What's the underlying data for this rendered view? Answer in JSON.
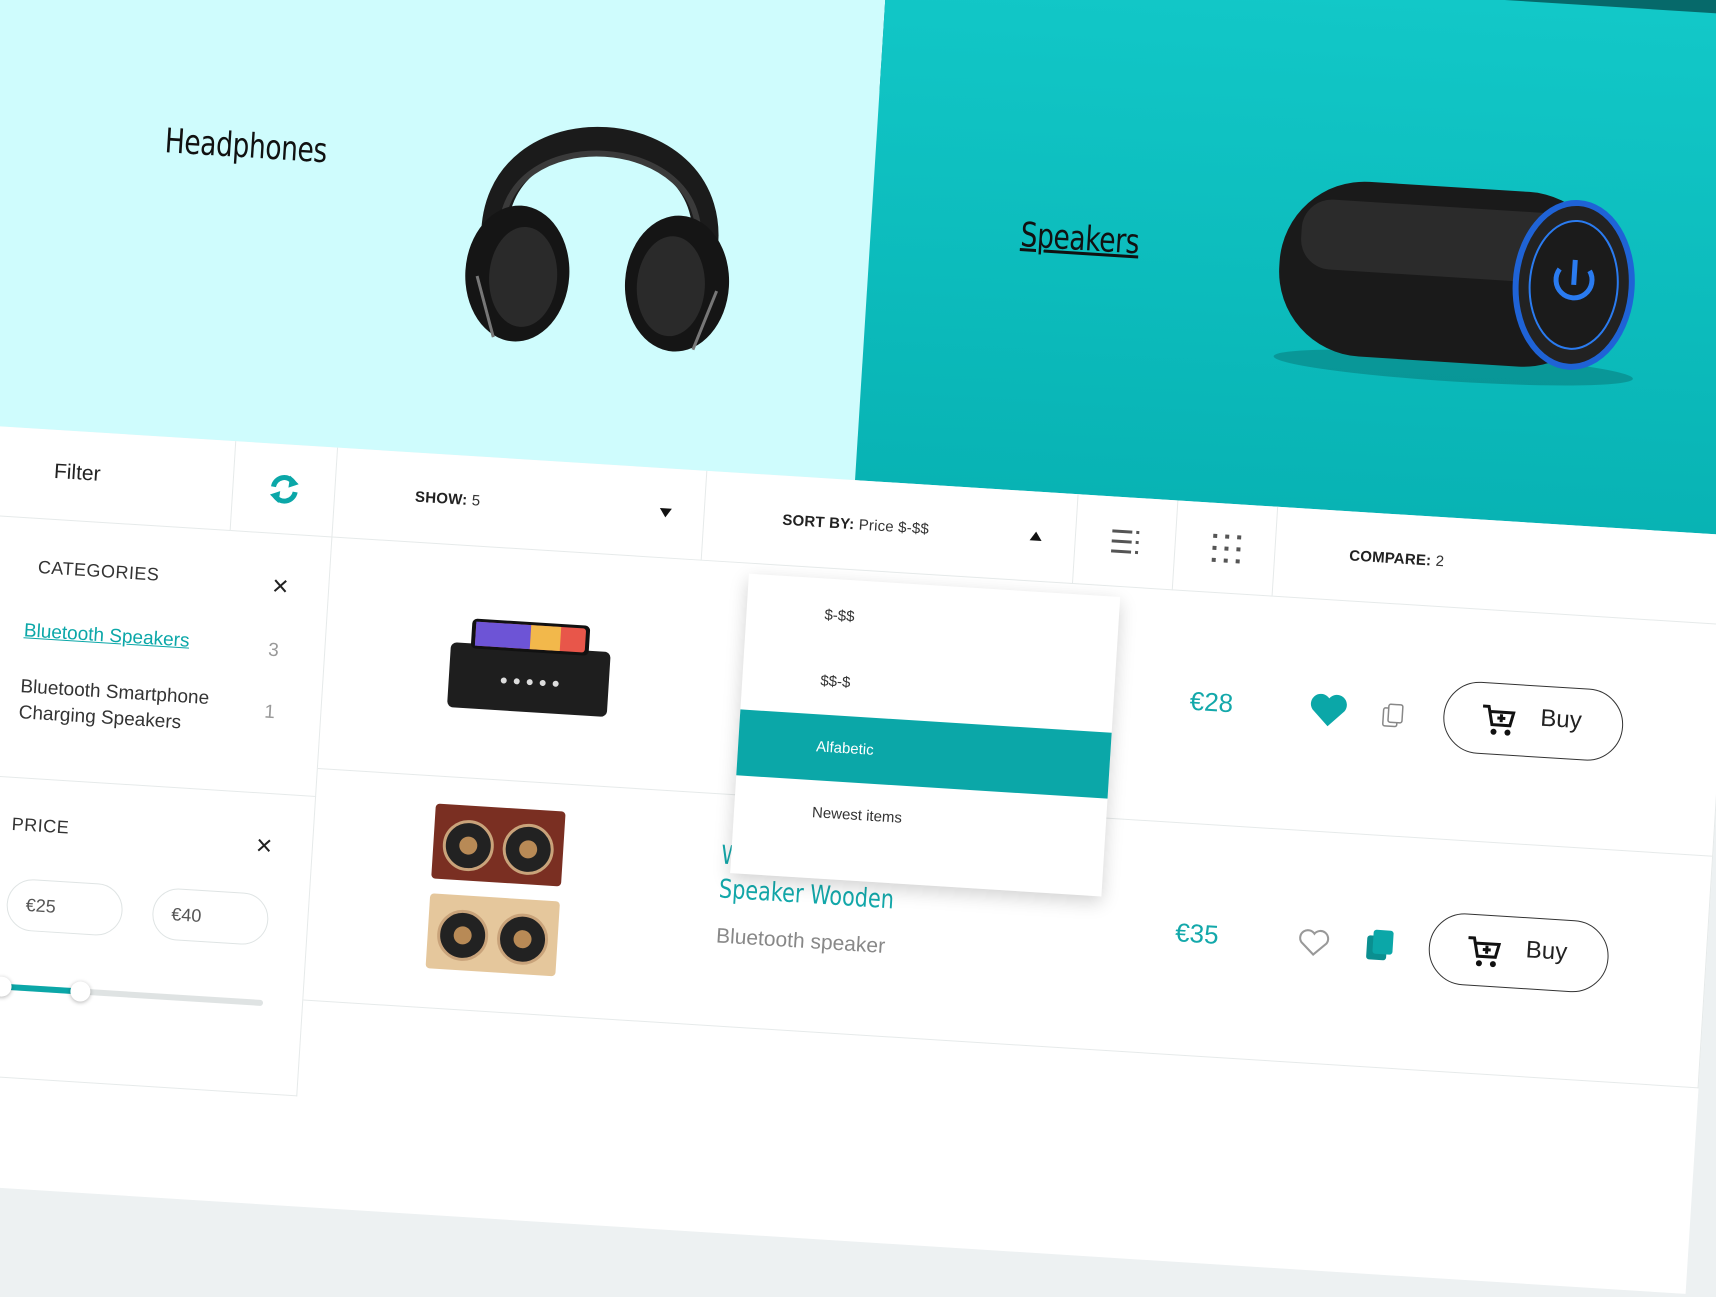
{
  "colors": {
    "accent": "#0ba7a8",
    "topbar": "#06696a",
    "hero_light": "#cffcfd",
    "hero_dark": "#08b3b4"
  },
  "hero": {
    "left_title": "Headphones",
    "right_title": "Speakers"
  },
  "toolbar": {
    "filter_label": "Filter",
    "refresh_icon": "refresh-icon",
    "show_label": "SHOW:",
    "show_value": "5",
    "sort_label": "SORT BY:",
    "sort_value": "Price $-$$",
    "compare_label": "COMPARE:",
    "compare_value": "2"
  },
  "sort_options": [
    "$-$$",
    "$$-$",
    "Alfabetic",
    "Newest items"
  ],
  "sort_active": "Alfabetic",
  "categories": {
    "heading": "CATEGORIES",
    "items": [
      {
        "label": "Bluetooth Speakers",
        "count": "3"
      },
      {
        "label": "Bluetooth  Smartphone Charging Speakers",
        "count": "1"
      }
    ]
  },
  "price_filter": {
    "heading": "PRICE",
    "min": "€25",
    "max": "€40",
    "range_fraction": [
      0.0,
      0.3
    ]
  },
  "products": [
    {
      "title": "",
      "subtitle": "",
      "price": "€28",
      "favorite": true
    },
    {
      "title": "W5 Wireless Bluetooth Dual Speaker Wooden",
      "subtitle": "Bluetooth speaker",
      "price": "€35",
      "favorite": false
    }
  ],
  "buttons": {
    "buy": "Buy"
  }
}
